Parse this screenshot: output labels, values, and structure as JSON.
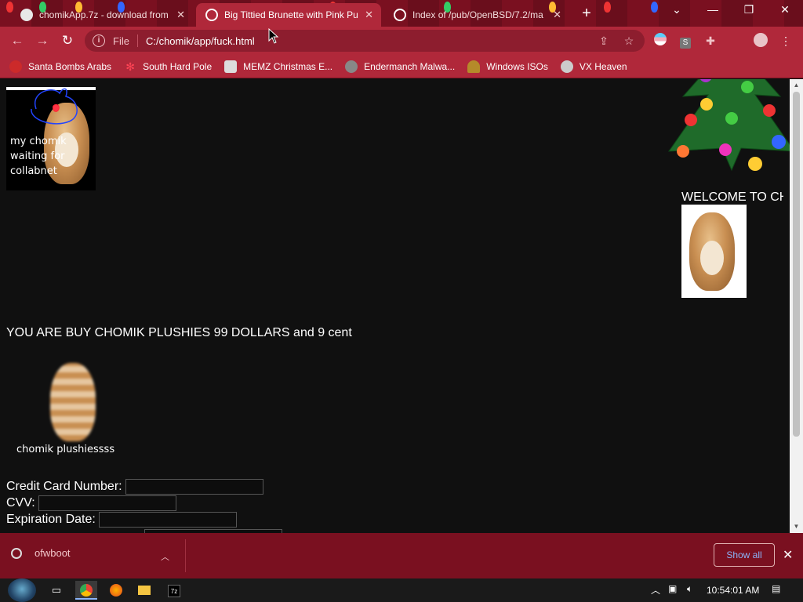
{
  "tabs": [
    {
      "title": "chomikApp.7z - download from",
      "active": false,
      "favicon_color": "#e8e8e8"
    },
    {
      "title": "Big Tittied Brunette with Pink Pus",
      "active": true,
      "favicon_color": "#ffffff"
    },
    {
      "title": "Index of /pub/OpenBSD/7.2/ma",
      "active": false,
      "favicon_color": "#ffffff"
    }
  ],
  "toolbar": {
    "file_label": "File",
    "url": "C:/chomik/app/fuck.html"
  },
  "bookmarks": [
    {
      "label": "Santa Bombs Arabs",
      "icon": "santa-icon"
    },
    {
      "label": "South Hard Pole",
      "icon": "snowflake-icon"
    },
    {
      "label": "MEMZ Christmas E...",
      "icon": "memz-icon"
    },
    {
      "label": "Endermanch Malwa...",
      "icon": "cat-icon"
    },
    {
      "label": "Windows ISOs",
      "icon": "trophy-icon"
    },
    {
      "label": "VX Heaven",
      "icon": "skull-icon"
    }
  ],
  "page": {
    "chomik_caption": "my chomik waiting for collabnet",
    "buy_line": "YOU ARE BUY CHOMIK PLUSHIES 99 DOLLARS and 9 cent",
    "plush_caption": "chomik plushiessss",
    "welcome": "WELCOME TO CH",
    "form": {
      "credit_card_label": "Credit Card Number:",
      "cvv_label": "CVV:",
      "expiration_label": "Expiration Date:"
    }
  },
  "download_bar": {
    "filename": "ofwboot",
    "show_all": "Show all"
  },
  "taskbar": {
    "time": "10:54:01 AM"
  },
  "colors": {
    "chrome_red": "#b0283a",
    "tabbar_red": "#7a1020",
    "page_bg": "#101010"
  }
}
